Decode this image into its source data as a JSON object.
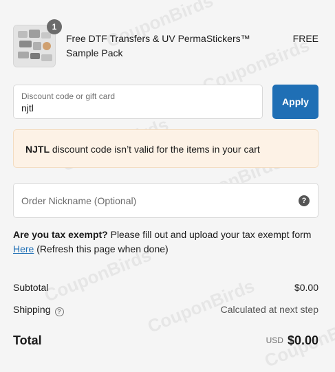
{
  "watermark": "CouponBirds",
  "product": {
    "quantity": "1",
    "name": "Free DTF Transfers & UV PermaStickers™ Sample Pack",
    "price": "FREE"
  },
  "discount": {
    "label": "Discount code or gift card",
    "value": "njtl",
    "apply_label": "Apply"
  },
  "error": {
    "code": "NJTL",
    "message": "discount code isn’t valid for the items in your cart"
  },
  "nickname": {
    "placeholder": "Order Nickname (Optional)",
    "help_icon": "question-circle-icon"
  },
  "tax": {
    "question": "Are you tax exempt?",
    "text": "Please fill out and upload your tax exempt form",
    "link": "Here",
    "after_link": "(Refresh this page when done)"
  },
  "summary": {
    "subtotal_label": "Subtotal",
    "subtotal_value": "$0.00",
    "shipping_label": "Shipping",
    "shipping_value": "Calculated at next step",
    "total_label": "Total",
    "currency": "USD",
    "total_value": "$0.00"
  },
  "colors": {
    "accent": "#1f6fb5",
    "error_bg": "#fdf2e6"
  }
}
